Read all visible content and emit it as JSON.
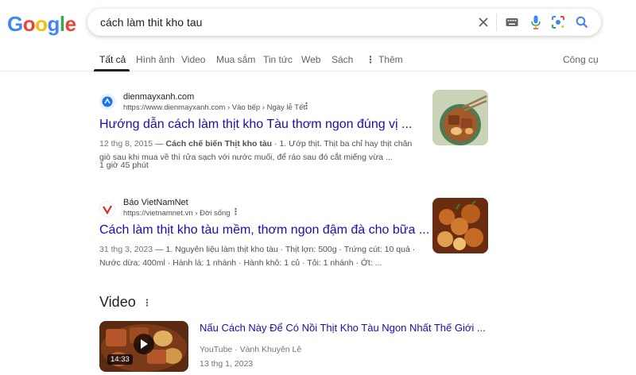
{
  "logo": {
    "letters": [
      "G",
      "o",
      "o",
      "g",
      "l",
      "e"
    ],
    "colors": [
      "#4285F4",
      "#EA4335",
      "#FBBC05",
      "#4285F4",
      "#34A853",
      "#EA4335"
    ]
  },
  "search": {
    "query": "cách làm thit kho tau"
  },
  "tabs": [
    {
      "label": "Tất cả",
      "active": true
    },
    {
      "label": "Hình ảnh"
    },
    {
      "label": "Video"
    },
    {
      "label": "Mua sắm"
    },
    {
      "label": "Tin tức"
    },
    {
      "label": "Web"
    },
    {
      "label": "Sách"
    },
    {
      "label": "Thêm"
    }
  ],
  "tools_label": "Công cụ",
  "results": [
    {
      "site_name": "dienmayxanh.com",
      "url": "https://www.dienmayxanh.com › Vào bếp › Ngày lễ Tết",
      "title": "Hướng dẫn cách làm thịt kho Tàu thơm ngon đúng vị ...",
      "date": "12 thg 8, 2015",
      "snippet_bold": "Cách chế biến Thịt kho tàu",
      "snippet_rest": " · 1. Ướp thịt. Thịt ba chỉ hay thịt chân giò sau khi mua về thì rửa sạch với nước muối, để ráo sau đó cắt miếng vừa ...",
      "extra": "1 giờ 45 phút"
    },
    {
      "site_name": "Báo VietNamNet",
      "url": "https://vietnamnet.vn › Đời sống",
      "title": "Cách làm thịt kho tàu mềm, thơm ngon đậm đà cho bữa ...",
      "date": "31 thg 3, 2023",
      "snippet_text": " — 1. Nguyên liệu làm thịt kho tàu · Thịt lợn: 500g · Trứng cút: 10 quả · Nước dừa: 400ml · Hành lá: 1 nhánh · Hành khô: 1 củ · Tỏi: 1 nhánh · Ớt: ..."
    }
  ],
  "video_section": {
    "heading": "Video",
    "title": "Nấu Cách Này Để Có Nồi Thịt Kho Tàu Ngon Nhất Thế Giới ...",
    "source": "YouTube · Vành Khuyên Lê",
    "date": "13 thg 1, 2023",
    "duration": "14:33"
  },
  "icons": [
    "clear-icon",
    "keyboard-icon",
    "mic-icon",
    "lens-icon",
    "search-icon",
    "more-vert-icon",
    "play-icon"
  ]
}
